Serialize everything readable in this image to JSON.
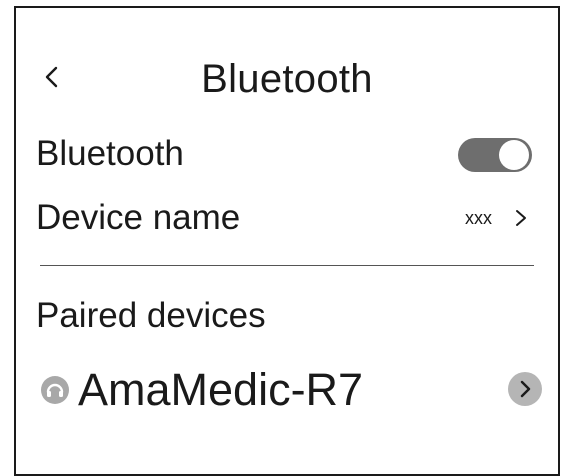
{
  "header": {
    "title": "Bluetooth",
    "back_icon": "chevron-left-icon"
  },
  "settings": {
    "bluetooth": {
      "label": "Bluetooth",
      "enabled": true,
      "toggle_color": "#6e6e6e"
    },
    "device_name": {
      "label": "Device name",
      "value": "xxx",
      "chevron_icon": "chevron-right-icon"
    }
  },
  "paired": {
    "section_title": "Paired devices",
    "devices": [
      {
        "name": "AmaMedic-R7",
        "icon": "bluetooth-device-icon",
        "action_icon": "chevron-right-circle-icon"
      }
    ]
  }
}
